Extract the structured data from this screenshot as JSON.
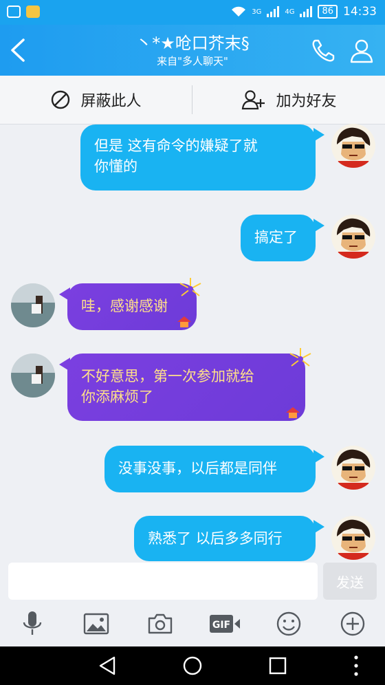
{
  "status_bar": {
    "network_3g": "3G",
    "network_4g": "4G",
    "battery": "86",
    "time": "14:33"
  },
  "header": {
    "title": "丶*★呛口芥末§",
    "subtitle": "来自\"多人聊天\""
  },
  "actions": {
    "block_label": "屏蔽此人",
    "add_friend_label": "加为好友"
  },
  "messages": [
    {
      "sender": "me",
      "text_line1": "但是 这有命令的嫌疑了就",
      "text_line2": "你懂的"
    },
    {
      "sender": "me",
      "text": "搞定了"
    },
    {
      "sender": "them",
      "text": "哇，感谢感谢"
    },
    {
      "sender": "them",
      "text_line1": "不好意思，第一次参加就给",
      "text_line2": "你添麻烦了"
    },
    {
      "sender": "me",
      "text": "没事没事，以后都是同伴"
    },
    {
      "sender": "me",
      "text": "熟悉了 以后多多同行"
    }
  ],
  "input": {
    "value": "",
    "placeholder": "",
    "send_label": "发送"
  },
  "toolbar": {
    "gif_label": "GIF"
  },
  "colors": {
    "header_blue": "#1e9cf0",
    "bubble_blue": "#19b3f2",
    "bubble_purple": "#7b3fe0",
    "purple_text": "#ffe08a"
  }
}
